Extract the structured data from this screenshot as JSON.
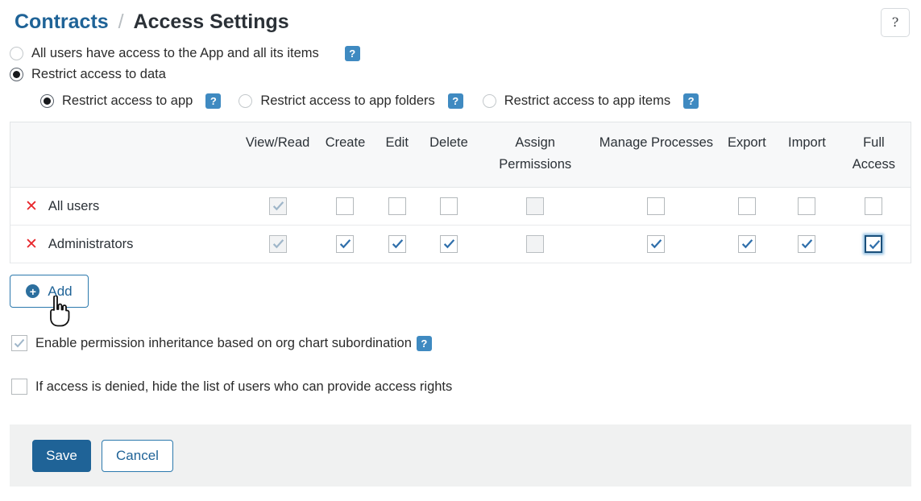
{
  "header": {
    "breadcrumb_parent": "Contracts",
    "breadcrumb_separator": "/",
    "breadcrumb_current": "Access Settings",
    "help_button_icon": "question-mark-icon",
    "accent_color": "#1f6397",
    "badge_color": "#3f8ac1"
  },
  "access_mode": {
    "options": [
      {
        "label": "All users have access to the App and all its items",
        "selected": false,
        "has_help": true
      },
      {
        "label": "Restrict access to data",
        "selected": true,
        "has_help": false
      }
    ]
  },
  "restrict_scope": {
    "options": [
      {
        "label": "Restrict access to app",
        "selected": true,
        "has_help": true
      },
      {
        "label": "Restrict access to app folders",
        "selected": false,
        "has_help": true
      },
      {
        "label": "Restrict access to app items",
        "selected": false,
        "has_help": true
      }
    ],
    "help_label": "?"
  },
  "permissions_table": {
    "columns": [
      {
        "id": "name",
        "label": ""
      },
      {
        "id": "view_read",
        "label": "View/Read"
      },
      {
        "id": "create",
        "label": "Create"
      },
      {
        "id": "edit",
        "label": "Edit"
      },
      {
        "id": "delete",
        "label": "Delete"
      },
      {
        "id": "assign_permissions",
        "label": "Assign Permissions"
      },
      {
        "id": "manage_processes",
        "label": "Manage Processes"
      },
      {
        "id": "export",
        "label": "Export"
      },
      {
        "id": "import",
        "label": "Import"
      },
      {
        "id": "full_access",
        "label": "Full Access"
      }
    ],
    "rows": [
      {
        "name": "All users",
        "delete_icon": "red-x-icon",
        "cells": [
          {
            "checked": true,
            "disabled": true,
            "focused": false
          },
          {
            "checked": false,
            "disabled": false,
            "focused": false
          },
          {
            "checked": false,
            "disabled": false,
            "focused": false
          },
          {
            "checked": false,
            "disabled": false,
            "focused": false
          },
          {
            "checked": false,
            "disabled": true,
            "focused": false
          },
          {
            "checked": false,
            "disabled": false,
            "focused": false
          },
          {
            "checked": false,
            "disabled": false,
            "focused": false
          },
          {
            "checked": false,
            "disabled": false,
            "focused": false
          },
          {
            "checked": false,
            "disabled": false,
            "focused": false
          }
        ]
      },
      {
        "name": "Administrators",
        "delete_icon": "red-x-icon",
        "cells": [
          {
            "checked": true,
            "disabled": true,
            "focused": false
          },
          {
            "checked": true,
            "disabled": false,
            "focused": false
          },
          {
            "checked": true,
            "disabled": false,
            "focused": false
          },
          {
            "checked": true,
            "disabled": false,
            "focused": false
          },
          {
            "checked": false,
            "disabled": true,
            "focused": false
          },
          {
            "checked": true,
            "disabled": false,
            "focused": false
          },
          {
            "checked": true,
            "disabled": false,
            "focused": false
          },
          {
            "checked": true,
            "disabled": false,
            "focused": false
          },
          {
            "checked": true,
            "disabled": false,
            "focused": true
          }
        ]
      }
    ]
  },
  "add_button": {
    "label": "Add",
    "icon": "plus-circle-icon",
    "plus_glyph": "+",
    "hovered": true,
    "cursor": "pointer-hand"
  },
  "options": [
    {
      "label": "Enable permission inheritance based on org chart subordination",
      "checked": true,
      "muted_check": true,
      "has_help": true
    },
    {
      "label": "If access is denied, hide the list of users who can provide access rights",
      "checked": false,
      "muted_check": false,
      "has_help": false
    }
  ],
  "footer": {
    "save_label": "Save",
    "cancel_label": "Cancel"
  }
}
